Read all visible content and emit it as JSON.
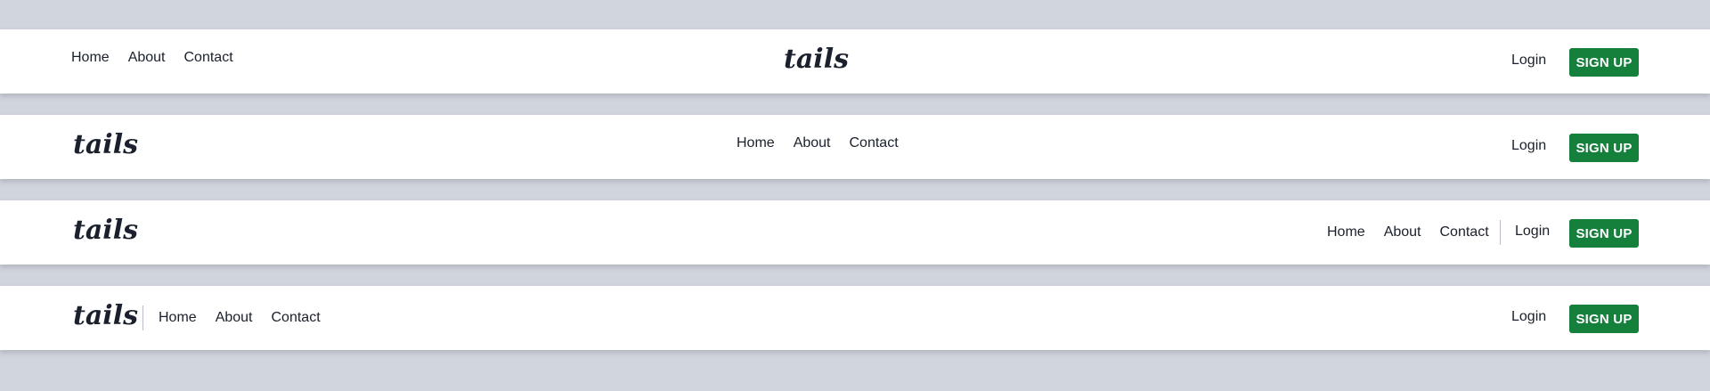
{
  "brand": {
    "logo_text": "tails",
    "logo_color": "#1a202c"
  },
  "colors": {
    "page_background": "#d1d5dd",
    "navbar_background": "#ffffff",
    "signup_background": "#157f3c",
    "text": "#1a202c"
  },
  "navbars": [
    {
      "variant": "links-left-logo-center",
      "links": [
        "Home",
        "About",
        "Contact"
      ],
      "login_label": "Login",
      "signup_label": "SIGN UP"
    },
    {
      "variant": "logo-left-links-center",
      "links": [
        "Home",
        "About",
        "Contact"
      ],
      "login_label": "Login",
      "signup_label": "SIGN UP"
    },
    {
      "variant": "logo-left-links-right",
      "links": [
        "Home",
        "About",
        "Contact"
      ],
      "login_label": "Login",
      "signup_label": "SIGN UP"
    },
    {
      "variant": "logo-and-links-left",
      "links": [
        "Home",
        "About",
        "Contact"
      ],
      "login_label": "Login",
      "signup_label": "SIGN UP"
    }
  ]
}
